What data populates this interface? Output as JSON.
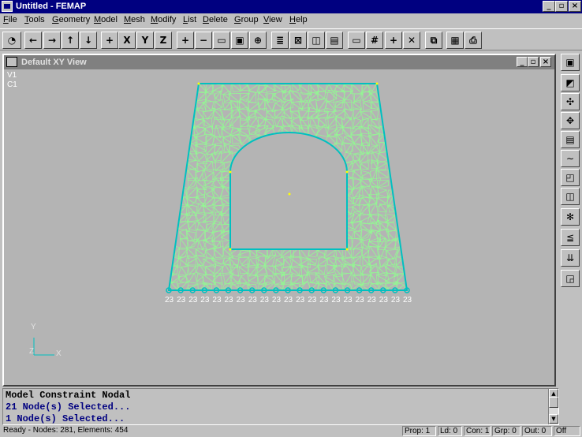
{
  "window": {
    "title": "Untitled - FEMAP"
  },
  "menu": [
    "File",
    "Tools",
    "Geometry",
    "Model",
    "Mesh",
    "Modify",
    "List",
    "Delete",
    "Group",
    "View",
    "Help"
  ],
  "toolbar": {
    "buttons": [
      "open",
      "arrow-left",
      "arrow-right",
      "arrow-up",
      "arrow-down",
      "plus",
      "rotate-x",
      "rotate-y",
      "rotate-z",
      "zoom-in",
      "zoom-out",
      "box-zoom",
      "autoscale",
      "center",
      "entity-list",
      "show-entities",
      "hidden-line",
      "solid",
      "render",
      "view-window",
      "grid",
      "crosshair",
      "delete-x",
      "copy",
      "paste",
      "print"
    ],
    "glyphs": {
      "arrow-left": "←",
      "arrow-right": "→",
      "arrow-up": "↑",
      "arrow-down": "↓",
      "plus": "+",
      "rotate-x": "X",
      "rotate-y": "Y",
      "rotate-z": "Z",
      "zoom-in": "+",
      "zoom-out": "−",
      "grid": "#",
      "crosshair": "+",
      "delete-x": "✕"
    }
  },
  "view": {
    "title": "Default XY View",
    "view_label": "V1",
    "csys_label": "C1",
    "axis_y": "Y",
    "axis_z": "Z",
    "axis_x": "X",
    "constraint_id": "23",
    "constraint_count": 21,
    "mesh_color": "#90ff90",
    "edge_color": "#00c0c0",
    "background": "#b4b4b4"
  },
  "right_toolbar": [
    "save",
    "geometry",
    "mesh-node",
    "mesh-element",
    "model-load",
    "curve",
    "surface",
    "solid",
    "mesh",
    "load",
    "constraint",
    "view-options"
  ],
  "messages": [
    {
      "text": "Model Constraint Nodal",
      "color": "#000000"
    },
    {
      "text": "21 Node(s) Selected...",
      "color": "#000080"
    },
    {
      "text": "1 Node(s) Selected...",
      "color": "#000080"
    }
  ],
  "status": {
    "ready": "Ready - Nodes: 281, Elements: 454",
    "prop": "Prop: 1",
    "ld": "Ld: 0",
    "con": "Con: 1",
    "grp": "Grp: 0",
    "out": "Out: 0",
    "off": "Off"
  }
}
